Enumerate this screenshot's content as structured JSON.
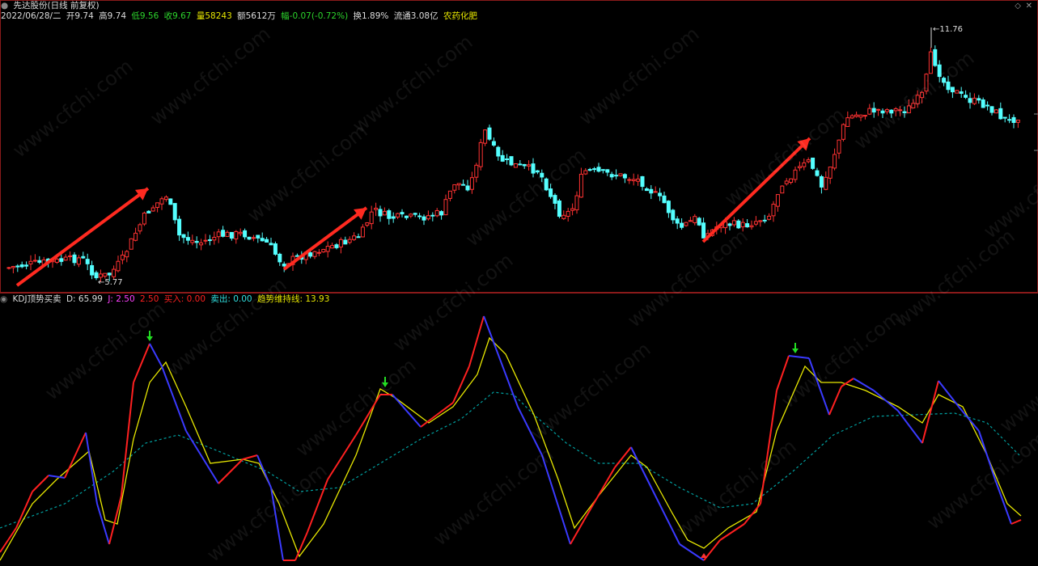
{
  "quote": {
    "title": "先达股份(日线 前复权)",
    "date": "2022/06/28/二",
    "open": "开9.74",
    "high": "高9.74",
    "low": "低9.56",
    "close": "收9.67",
    "volume": "量58243",
    "amount": "额5612万",
    "change": "幅-0.07(-0.72%)",
    "turnover": "换1.89%",
    "float": "流通3.08亿",
    "sector": "农药化肥"
  },
  "price_labels": {
    "high_label": "11.76",
    "low_label": "5.77"
  },
  "indicator": {
    "name": "KDJ顶势买卖",
    "d": "D: 65.99",
    "j": "J: 2.50",
    "k": "2.50",
    "buy": "买入: 0.00",
    "sell": "卖出: 0.00",
    "trend": "趋势维持线: 13.93"
  },
  "watermark": "www.cfchi.com",
  "colors": {
    "up": "#ff3232",
    "down": "#54ffff",
    "k_line": "#ff2020",
    "k_fall": "#3a3aff",
    "d_line": "#e8e800",
    "trend_line": "#00a0a0",
    "arrow": "#ff2a20",
    "border": "#8a1a1a",
    "sell_arrow": "#22dd22",
    "buy_arrow": "#ff3232"
  },
  "icons": {
    "menu": "circle-icon",
    "diamond": "diamond-icon",
    "close": "close-icon"
  }
}
